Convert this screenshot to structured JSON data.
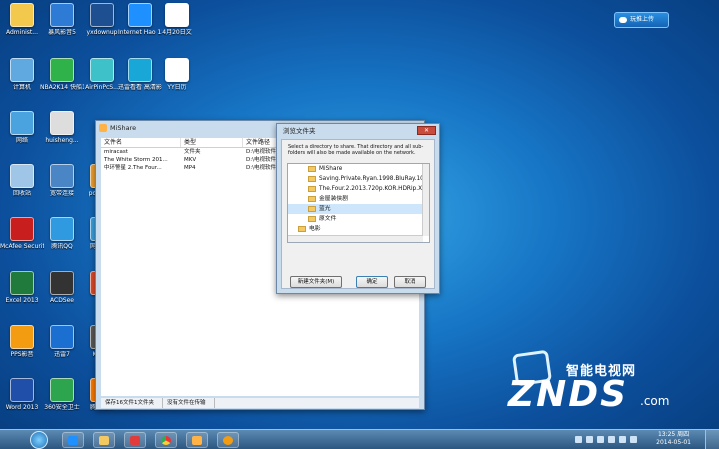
{
  "desktop_icons": [
    {
      "label": "Administ...",
      "color": "#f2c94c"
    },
    {
      "label": "暴风影音5",
      "color": "#2e7bd6"
    },
    {
      "label": "yxdownup",
      "color": "#1d4f91"
    },
    {
      "label": "Internet Hao 123",
      "color": "#1e90ff"
    },
    {
      "label": "4月20日文",
      "color": "#ffffff"
    },
    {
      "label": "计算机",
      "color": "#5fa8e0"
    },
    {
      "label": "NBA2K14 快船118-1...",
      "color": "#2fb24a"
    },
    {
      "label": "AirPinPcS...",
      "color": "#3fc1c9"
    },
    {
      "label": "迅雷看看 高清影视",
      "color": "#18a7d6"
    },
    {
      "label": "YY日历",
      "color": "#ffffff"
    },
    {
      "label": "网络",
      "color": "#4aa3df"
    },
    {
      "label": "huisheng...",
      "color": "#dddddd"
    },
    {
      "label": "回收站",
      "color": "#9fc6e6"
    },
    {
      "label": "宽带连接",
      "color": "#4a86c5"
    },
    {
      "label": "pointer...",
      "color": "#f0a030"
    },
    {
      "label": "McAfee Security...",
      "color": "#c81e1e"
    },
    {
      "label": "腾讯QQ",
      "color": "#2f9ae0"
    },
    {
      "label": "网络连接",
      "color": "#3da0e0"
    },
    {
      "label": "Excel 2013",
      "color": "#1f7a3c"
    },
    {
      "label": "ACDSee",
      "color": "#333333"
    },
    {
      "label": "分享",
      "color": "#e04a2a"
    },
    {
      "label": "PPS影音",
      "color": "#f39c12"
    },
    {
      "label": "迅雷7",
      "color": "#1b6fd0"
    },
    {
      "label": "Kinect",
      "color": "#5a5a5a"
    },
    {
      "label": "Word 2013",
      "color": "#1f4fa8"
    },
    {
      "label": "360安全卫士",
      "color": "#2da44e"
    },
    {
      "label": "腾讯视频",
      "color": "#ff7b00"
    }
  ],
  "upload_button": {
    "label": "玩推上传"
  },
  "mishare": {
    "title": "MiShare",
    "columns": [
      "文件名",
      "类型",
      "文件路径"
    ],
    "rows": [
      {
        "name": "miracast",
        "type": "文件夹",
        "path": "D:\\电视软件"
      },
      {
        "name": "The White Storm 201...",
        "type": "MKV",
        "path": "D:\\电视软件"
      },
      {
        "name": "中环警星 2.The Four...",
        "type": "MP4",
        "path": "D:\\电视软件"
      }
    ],
    "status": {
      "left": "保存16文件1文件夹",
      "right": "没有文件在传输"
    }
  },
  "browse_dialog": {
    "title": "浏览文件夹",
    "message": "Select a directory to share. That directory and all sub-folders will also be made available on the network.",
    "tree": [
      {
        "label": "MiShare",
        "selected": false
      },
      {
        "label": "Saving.Private.Ryan.1998.BluRay.10",
        "selected": false
      },
      {
        "label": "The.Four.2.2013.720p.KOR.HDRip.X",
        "selected": false
      },
      {
        "label": "金屋装侠剧",
        "selected": false
      },
      {
        "label": "蓝光",
        "selected": true
      },
      {
        "label": "原文件",
        "selected": false
      },
      {
        "label": "电影",
        "selected": false
      }
    ],
    "buttons": {
      "new_folder": "新建文件夹(M)",
      "ok": "确定",
      "cancel": "取消"
    }
  },
  "logo": {
    "cn": "智能电视网",
    "main": "ZNDS",
    "suffix": ".com"
  },
  "taskbar": {
    "time": "13:25 周四",
    "date": "2014-05-01"
  }
}
